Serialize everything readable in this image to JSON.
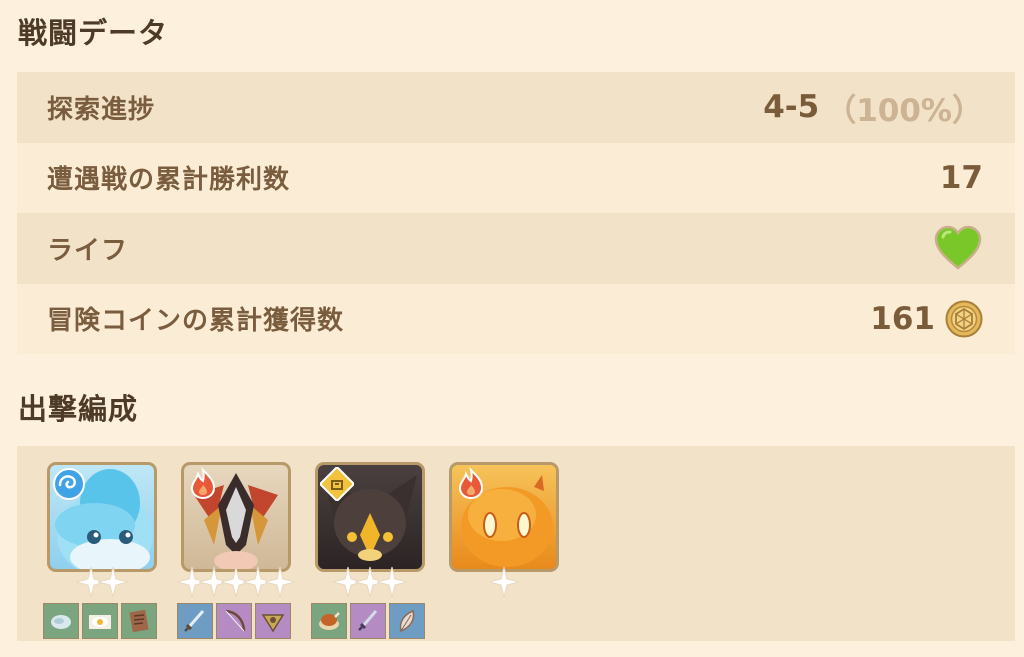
{
  "stats_title": "戦闘データ",
  "team_title": "出撃編成",
  "stats": [
    {
      "label": "探索進捗",
      "value": "4-5",
      "extra": "（100%）"
    },
    {
      "label": "遭遇戦の累計勝利数",
      "value": "17"
    },
    {
      "label": "ライフ",
      "icon": "heart-icon",
      "icon_color": "#7ac72a"
    },
    {
      "label": "冒険コインの累計獲得数",
      "value": "161",
      "icon": "coin-icon"
    }
  ],
  "team": [
    {
      "name": "water-slime-character",
      "element": "hydro",
      "stars": 2,
      "gear": [
        "green",
        "green",
        "green"
      ]
    },
    {
      "name": "fire-masked-character",
      "element": "pyro",
      "stars": 5,
      "gear": [
        "blue",
        "purple",
        "purple"
      ]
    },
    {
      "name": "dark-beast-character",
      "element": "geo",
      "stars": 3,
      "gear": [
        "green",
        "purple",
        "blue"
      ]
    },
    {
      "name": "fire-slime-character",
      "element": "pyro",
      "stars": 1,
      "gear": []
    }
  ],
  "colors": {
    "background": "#fdf1dd",
    "row_dark": "#f2e2c8",
    "row_light": "#fbecd5",
    "text": "#7a5d3e",
    "heart": "#7ac72a"
  }
}
